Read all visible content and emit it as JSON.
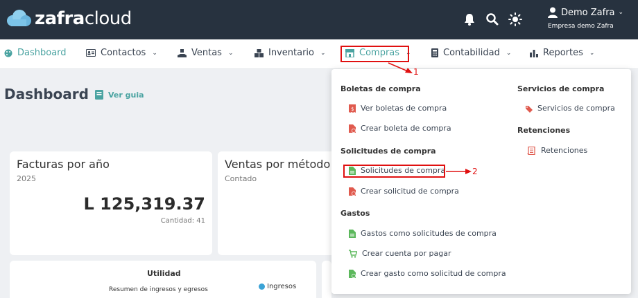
{
  "brand": {
    "name_bold": "zafra",
    "name_light": "cloud"
  },
  "topbar": {
    "icons": [
      "bell-icon",
      "search-icon",
      "sun-icon",
      "user-icon"
    ],
    "user_name": "Demo Zafra",
    "company": "Empresa demo Zafra"
  },
  "nav": {
    "items": [
      {
        "label": "Dashboard",
        "icon": "palette-icon"
      },
      {
        "label": "Contactos",
        "icon": "contact-card-icon"
      },
      {
        "label": "Ventas",
        "icon": "hand-sale-icon"
      },
      {
        "label": "Inventario",
        "icon": "boxes-icon"
      },
      {
        "label": "Compras",
        "icon": "store-icon"
      },
      {
        "label": "Contabilidad",
        "icon": "calculator-icon"
      },
      {
        "label": "Reportes",
        "icon": "bar-chart-icon"
      }
    ]
  },
  "page": {
    "title": "Dashboard",
    "guide_label": "Ver guia"
  },
  "cards": {
    "facturas": {
      "title": "Facturas por año",
      "year": "2025",
      "amount": "L 125,319.37",
      "count": "Cantidad: 41"
    },
    "ventas": {
      "title": "Ventas por método",
      "sub": "Contado"
    },
    "utilidad": {
      "title": "Utilidad",
      "sub": "Resumen de ingresos y egresos",
      "legend": "Ingresos"
    }
  },
  "dropdown": {
    "boletas": {
      "header": "Boletas de compra",
      "items": [
        "Ver boletas de compra",
        "Crear boleta de compra"
      ]
    },
    "solicitudes": {
      "header": "Solicitudes de compra",
      "items": [
        "Solicitudes de compra",
        "Crear solicitud de compra"
      ]
    },
    "gastos": {
      "header": "Gastos",
      "items": [
        "Gastos como solicitudes de compra",
        "Crear cuenta por pagar",
        "Crear gasto como solicitud de compra"
      ]
    },
    "servicios": {
      "header": "Servicios de compra",
      "items": [
        "Servicios de compra"
      ]
    },
    "retenciones": {
      "header": "Retenciones",
      "items": [
        "Retenciones"
      ]
    }
  },
  "annotations": {
    "step1": "1",
    "step2": "2"
  },
  "colors": {
    "topbar": "#27323f",
    "accent": "#4aa3a1",
    "highlight": "#e01010",
    "icon_red": "#e05a4e",
    "icon_green": "#5cb85c"
  }
}
